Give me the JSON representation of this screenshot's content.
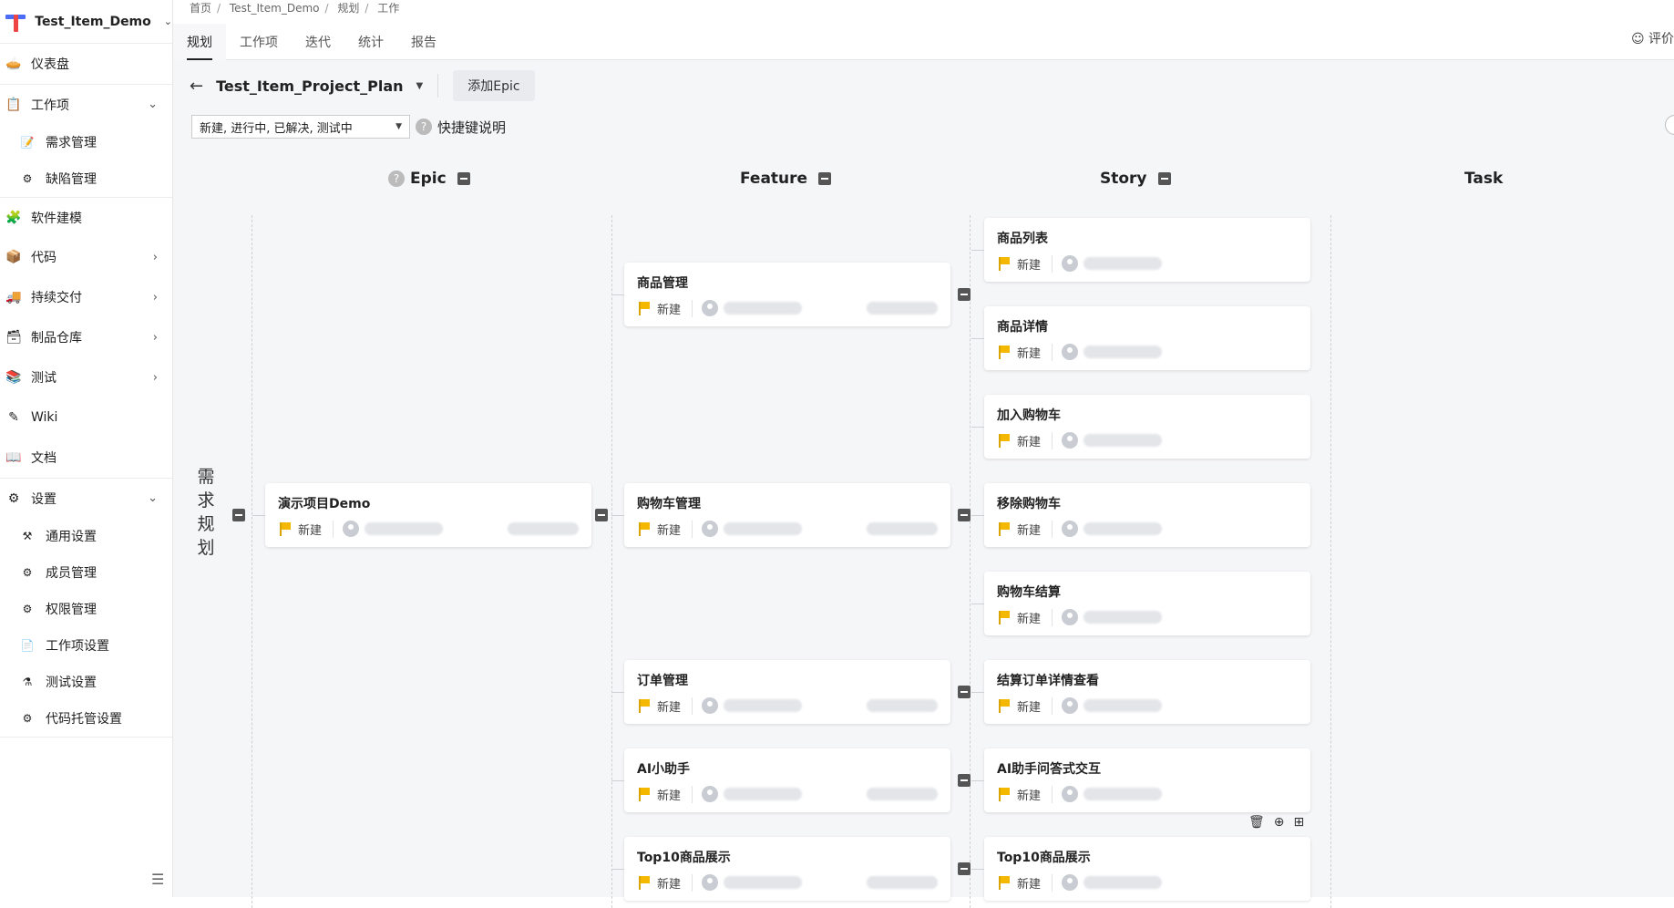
{
  "project": {
    "name": "Test_Item_Demo"
  },
  "sidebar": {
    "items": [
      {
        "label": "仪表盘"
      },
      {
        "label": "工作项"
      },
      {
        "label": "需求管理"
      },
      {
        "label": "缺陷管理"
      },
      {
        "label": "软件建模"
      },
      {
        "label": "代码"
      },
      {
        "label": "持续交付"
      },
      {
        "label": "制品仓库"
      },
      {
        "label": "测试"
      },
      {
        "label": "Wiki"
      },
      {
        "label": "文档"
      },
      {
        "label": "设置"
      },
      {
        "label": "通用设置"
      },
      {
        "label": "成员管理"
      },
      {
        "label": "权限管理"
      },
      {
        "label": "工作项设置"
      },
      {
        "label": "测试设置"
      },
      {
        "label": "代码托管设置"
      }
    ]
  },
  "breadcrumb": [
    "首页",
    "Test_Item_Demo",
    "规划",
    "工作"
  ],
  "tabs": [
    "规划",
    "工作项",
    "迭代",
    "统计",
    "报告"
  ],
  "feedback_label": "评价",
  "plan": {
    "name": "Test_Item_Project_Plan",
    "add_epic_label": "添加Epic"
  },
  "filter": {
    "selected": "新建, 进行中, 已解决, 测试中",
    "shortcut_label": "快捷键说明"
  },
  "columns": {
    "epic": "Epic",
    "feature": "Feature",
    "story": "Story",
    "task": "Task"
  },
  "row_label": "需求规划",
  "epic_cards": [
    {
      "title": "演示项目Demo",
      "status": "新建"
    }
  ],
  "feature_cards": [
    {
      "title": "商品管理",
      "status": "新建"
    },
    {
      "title": "购物车管理",
      "status": "新建"
    },
    {
      "title": "订单管理",
      "status": "新建"
    },
    {
      "title": "AI小助手",
      "status": "新建"
    },
    {
      "title": "Top10商品展示",
      "status": "新建"
    }
  ],
  "story_cards": [
    {
      "title": "商品列表",
      "status": "新建"
    },
    {
      "title": "商品详情",
      "status": "新建"
    },
    {
      "title": "加入购物车",
      "status": "新建"
    },
    {
      "title": "移除购物车",
      "status": "新建"
    },
    {
      "title": "购物车结算",
      "status": "新建"
    },
    {
      "title": "结算订单详情查看",
      "status": "新建"
    },
    {
      "title": "AI助手问答式交互",
      "status": "新建"
    },
    {
      "title": "Top10商品展示",
      "status": "新建"
    }
  ],
  "colors": {
    "flag": "#f5b800",
    "background": "#f5f6f8"
  }
}
